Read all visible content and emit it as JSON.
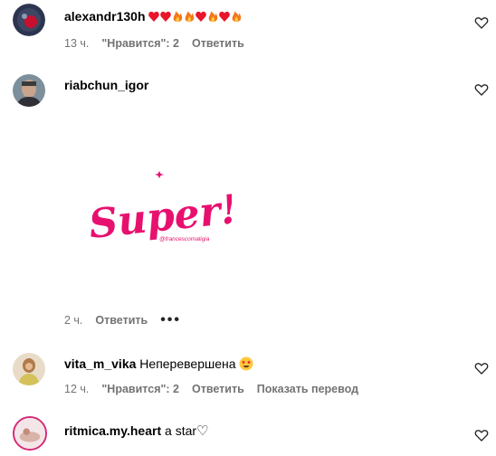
{
  "comments": [
    {
      "username": "alexandr130h",
      "text": "",
      "emoji_text": "❤❤🔥🔥❤🔥❤🔥",
      "time": "13 ч.",
      "likes": "\"Нравится\": 2",
      "reply": "Ответить"
    },
    {
      "username": "riabchun_igor",
      "sticker": {
        "word": "Super!",
        "handle": "@francescomaligia"
      },
      "time": "2 ч.",
      "reply": "Ответить",
      "more": "•••"
    },
    {
      "username": "vita_m_vika",
      "text": "Неперевершена",
      "emoji_text": "🤩",
      "time": "12 ч.",
      "likes": "\"Нравится\": 2",
      "reply": "Ответить",
      "translate": "Показать перевод"
    },
    {
      "username": "ritmica.my.heart",
      "text": "a star",
      "emoji_text": "♡"
    }
  ],
  "colors": {
    "meta_text": "#737373",
    "sticker_pink": "#e8106f",
    "heart_red": "#e8152b",
    "fire_orange": "#f2781c"
  },
  "icons": {
    "like": "heart-outline-icon",
    "more": "more-dots-icon"
  }
}
